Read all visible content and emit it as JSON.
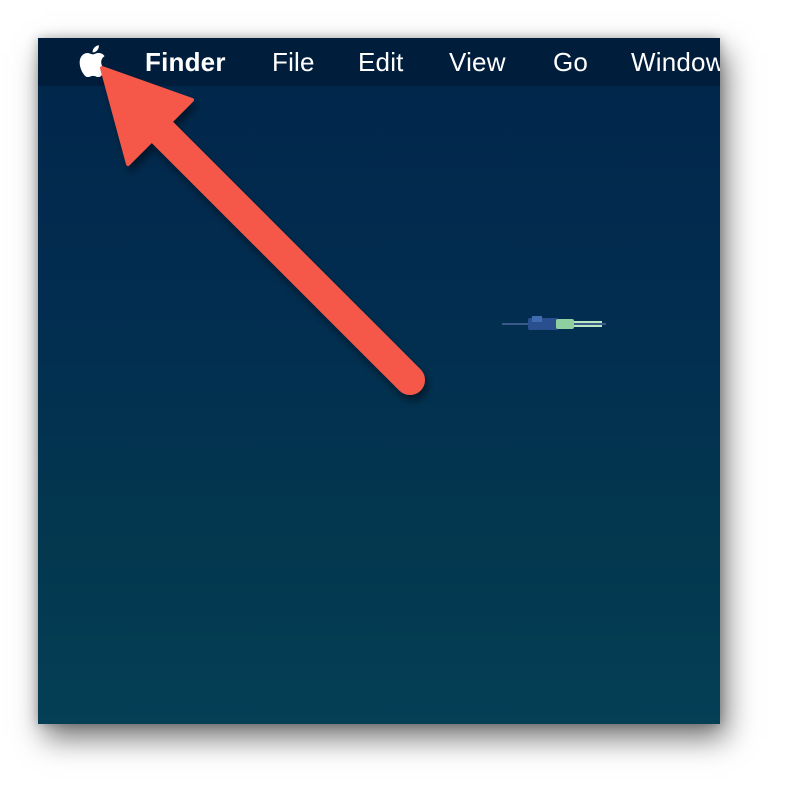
{
  "menubar": {
    "app_name": "Finder",
    "items": [
      {
        "label": "File"
      },
      {
        "label": "Edit"
      },
      {
        "label": "View"
      },
      {
        "label": "Go"
      },
      {
        "label": "Window"
      }
    ]
  },
  "colors": {
    "desktop_top": "#01264a",
    "desktop_bottom": "#043f56",
    "arrow": "#f5584a",
    "menu_text": "#ffffff"
  },
  "icons": {
    "apple": "apple-logo-icon",
    "annotation": "red-arrow-annotation",
    "desktop_object": "satellite-icon"
  }
}
